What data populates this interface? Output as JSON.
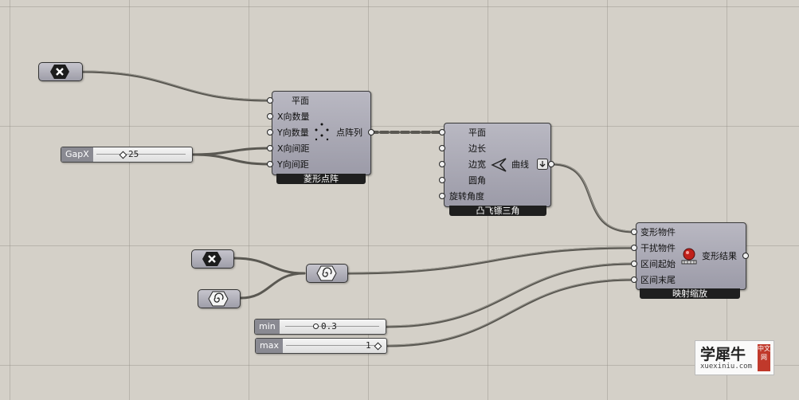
{
  "lattice_component": {
    "inputs": [
      "平面",
      "X向数量",
      "Y向数量",
      "X向间距",
      "Y向间距"
    ],
    "output": "点阵列",
    "footer": "菱形点阵"
  },
  "triangle_component": {
    "inputs": [
      "平面",
      "边长",
      "边宽",
      "圆角",
      "旋转角度"
    ],
    "output": "曲线",
    "footer": "凸飞镖三角"
  },
  "map_component": {
    "inputs": [
      "变形物件",
      "干扰物件",
      "区间起始",
      "区间末尾"
    ],
    "output": "变形结果",
    "footer": "映射缩放"
  },
  "sliders": {
    "gapx": {
      "label": "GapX",
      "value": "25"
    },
    "min": {
      "label": "min",
      "value": "0.3"
    },
    "max": {
      "label": "max",
      "value": "1"
    }
  },
  "icons": {
    "param_top": "crossed-x-icon",
    "param_mid": "crossed-x-icon",
    "param_spiral_left": "spiral-icon",
    "param_spiral_center": "spiral-icon",
    "triangle": "dart-shape-icon",
    "map": "ball-icon",
    "lattice": "dot-grid-icon"
  },
  "watermark": {
    "name": "学犀牛",
    "url": "xuexiniu.com",
    "badge": "中文网"
  },
  "colors": {
    "canvas": "#d4d0c8",
    "component": "#a9a8b4",
    "footer": "#1f1f1f",
    "wire": "#5a5852"
  }
}
